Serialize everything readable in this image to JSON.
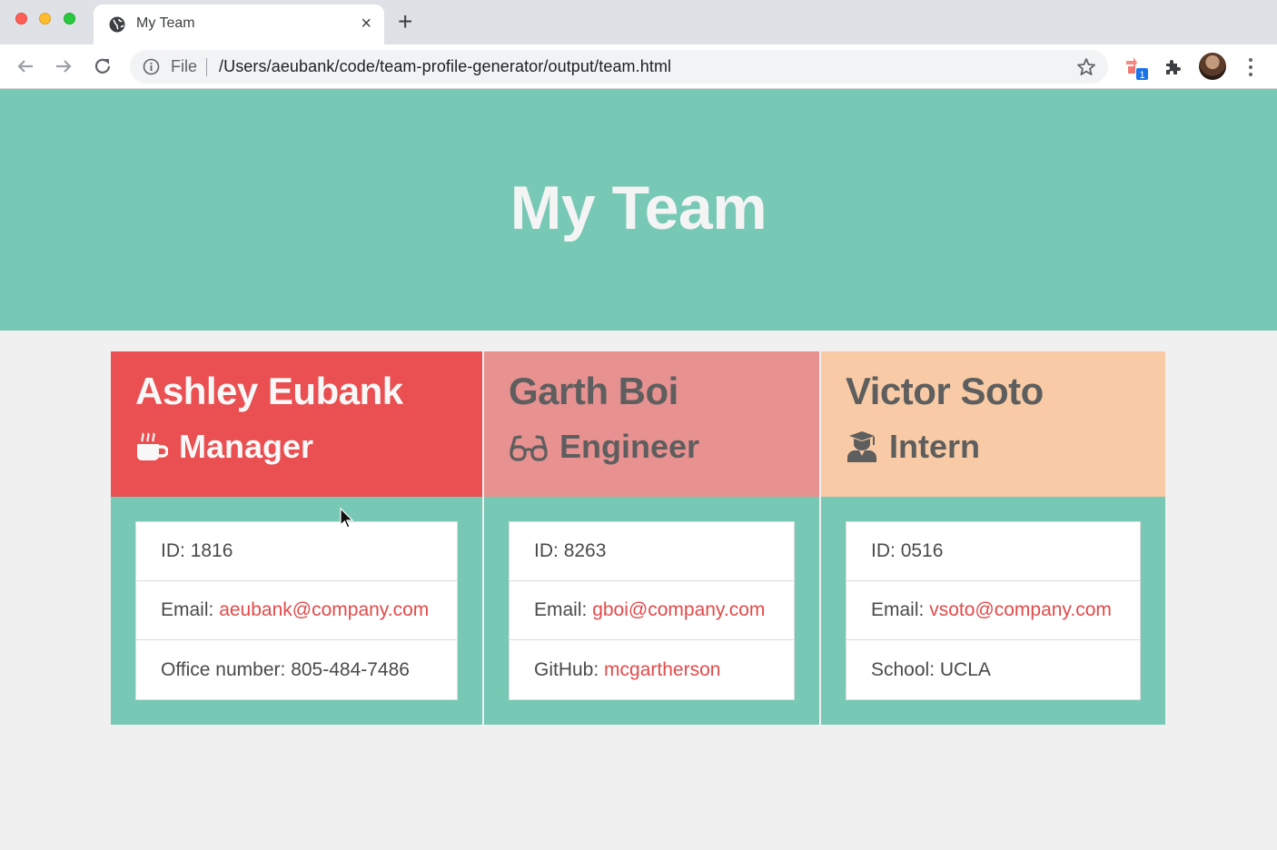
{
  "browser": {
    "tab_title": "My Team",
    "close_glyph": "×",
    "new_tab_glyph": "+",
    "omnibox_scheme": "File",
    "url": "/Users/aeubank/code/team-profile-generator/output/team.html",
    "extension_badge": "1"
  },
  "page": {
    "title": "My Team",
    "link_color": "#e34a4a",
    "hero_color": "#78c8b6"
  },
  "cards": [
    {
      "name": "Ashley Eubank",
      "role": "Manager",
      "icon": "coffee-mug-icon",
      "header_color": "#ea4f51",
      "id_label": "ID: ",
      "id": "1816",
      "email_label": "Email: ",
      "email": "aeubank@company.com",
      "extra_label": "Office number: ",
      "extra": "805-484-7486"
    },
    {
      "name": "Garth Boi",
      "role": "Engineer",
      "icon": "glasses-icon",
      "header_color": "#e79191",
      "id_label": "ID: ",
      "id": "8263",
      "email_label": "Email: ",
      "email": "gboi@company.com",
      "extra_label": "GitHub: ",
      "extra": "mcgartherson"
    },
    {
      "name": "Victor Soto",
      "role": "Intern",
      "icon": "graduate-icon",
      "header_color": "#f8cba6",
      "id_label": "ID: ",
      "id": "0516",
      "email_label": "Email: ",
      "email": "vsoto@company.com",
      "extra_label": "School: ",
      "extra": "UCLA"
    }
  ]
}
